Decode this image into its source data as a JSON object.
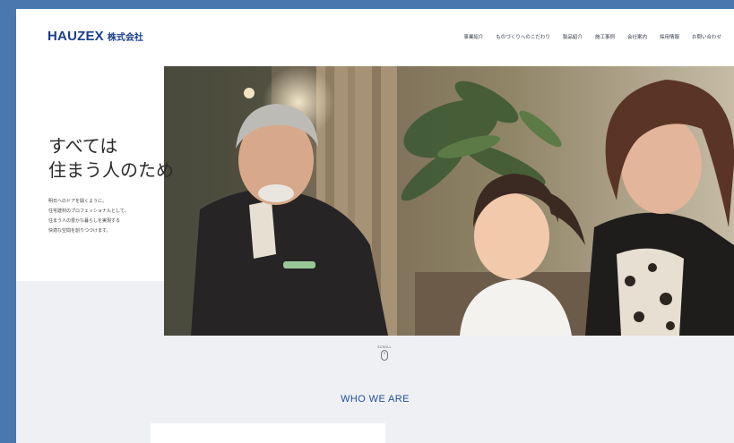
{
  "header": {
    "logo_mark": "HAUZEX",
    "logo_sub": "株式会社",
    "nav": [
      "事業紹介",
      "ものづくりへのこだわり",
      "製品紹介",
      "施工事例",
      "会社案内",
      "採用情報",
      "お問い合わせ"
    ]
  },
  "hero": {
    "headline_lines": [
      "すべては",
      "住まう人のため"
    ],
    "lead_lines": [
      "明日へのドアを開くように。",
      "住宅建材のプロフェッショナルとして、",
      "住まう人の豊かな暮らしを実現する",
      "快適な空間を創りつづけます。"
    ]
  },
  "scroll": {
    "label": "SCROLL"
  },
  "section": {
    "title": "WHO WE ARE"
  },
  "colors": {
    "frame": "#4a77ad",
    "brand": "#1b3f8c",
    "accent": "#1e4f9e",
    "background": "#eef0f4"
  }
}
